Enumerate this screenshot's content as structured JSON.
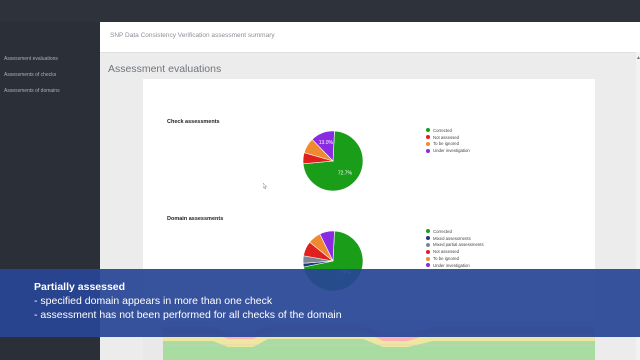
{
  "sidebar": {
    "items": [
      {
        "label": "Assessment evaluations"
      },
      {
        "label": "Assessments of checks"
      },
      {
        "label": "Assessments of domains"
      }
    ]
  },
  "header": {
    "title": "SNP Data Consistency Verification assessment summary"
  },
  "main": {
    "section_title": "Assessment evaluations"
  },
  "colors": {
    "corrected": "#1a9e1a",
    "not_assessed": "#e01f1f",
    "to_be_ignored": "#f08a30",
    "under_investigation": "#8a2be2",
    "mixed_assessments": "#1f3a78",
    "mixed_partial_assessments": "#7b8796",
    "overlay": "#2846a0"
  },
  "chart_data": [
    {
      "type": "pie",
      "title": "Check assessments",
      "labels": [
        "Corrected",
        "Not assessed",
        "To be ignored",
        "Under investigation"
      ],
      "values": [
        72.7,
        6.0,
        8.3,
        13.0
      ],
      "data_labels": [
        "72.7%",
        "",
        "",
        "13.0%"
      ],
      "legend": "right"
    },
    {
      "type": "pie",
      "title": "Domain assessments",
      "labels": [
        "Corrected",
        "Mixed assessments",
        "Mixed partial assessments",
        "Not assessed",
        "To be ignored",
        "Under investigation"
      ],
      "values": [
        71,
        2,
        4,
        8,
        7,
        8
      ],
      "data_labels": [
        "71%",
        "",
        "",
        "",
        "",
        ""
      ],
      "legend": "right"
    }
  ],
  "overlay": {
    "title": "Partially assessed",
    "lines": [
      "- specified domain appears in more than one check",
      "- assessment has not been performed for all checks of the domain"
    ]
  }
}
